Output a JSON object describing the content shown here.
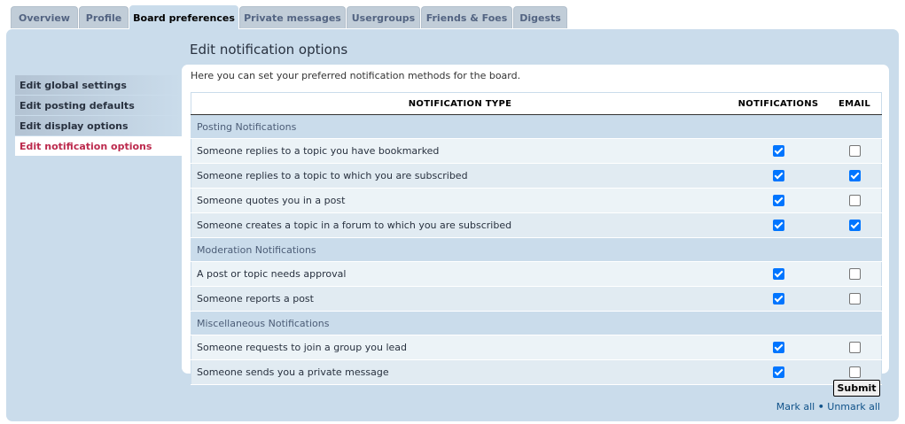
{
  "tabs": [
    {
      "label": "Overview",
      "active": false
    },
    {
      "label": "Profile",
      "active": false
    },
    {
      "label": "Board preferences",
      "active": true
    },
    {
      "label": "Private messages",
      "active": false
    },
    {
      "label": "Usergroups",
      "active": false
    },
    {
      "label": "Friends & Foes",
      "active": false
    },
    {
      "label": "Digests",
      "active": false
    }
  ],
  "page_title": "Edit notification options",
  "menu": [
    {
      "label": "Edit global settings",
      "active": false
    },
    {
      "label": "Edit posting defaults",
      "active": false
    },
    {
      "label": "Edit display options",
      "active": false
    },
    {
      "label": "Edit notification options",
      "active": true
    }
  ],
  "intro": "Here you can set your preferred notification methods for the board.",
  "table": {
    "col_type": "Notification type",
    "col_notifications": "Notifications",
    "col_email": "Email",
    "sections": [
      {
        "title": "Posting Notifications",
        "rows": [
          {
            "label": "Someone replies to a topic you have bookmarked",
            "notify": true,
            "email": false
          },
          {
            "label": "Someone replies to a topic to which you are subscribed",
            "notify": true,
            "email": true
          },
          {
            "label": "Someone quotes you in a post",
            "notify": true,
            "email": false
          },
          {
            "label": "Someone creates a topic in a forum to which you are subscribed",
            "notify": true,
            "email": true
          }
        ]
      },
      {
        "title": "Moderation Notifications",
        "rows": [
          {
            "label": "A post or topic needs approval",
            "notify": true,
            "email": false
          },
          {
            "label": "Someone reports a post",
            "notify": true,
            "email": false
          }
        ]
      },
      {
        "title": "Miscellaneous Notifications",
        "rows": [
          {
            "label": "Someone requests to join a group you lead",
            "notify": true,
            "email": false
          },
          {
            "label": "Someone sends you a private message",
            "notify": true,
            "email": false
          }
        ]
      }
    ]
  },
  "submit_label": "Submit",
  "mark_all": "Mark all",
  "separator": "•",
  "unmark_all": "Unmark all",
  "colors": {
    "panel": "#cadceb",
    "active_menu_text": "#bc2a4d",
    "link": "#105289",
    "checkbox_on": "#0075ff"
  }
}
